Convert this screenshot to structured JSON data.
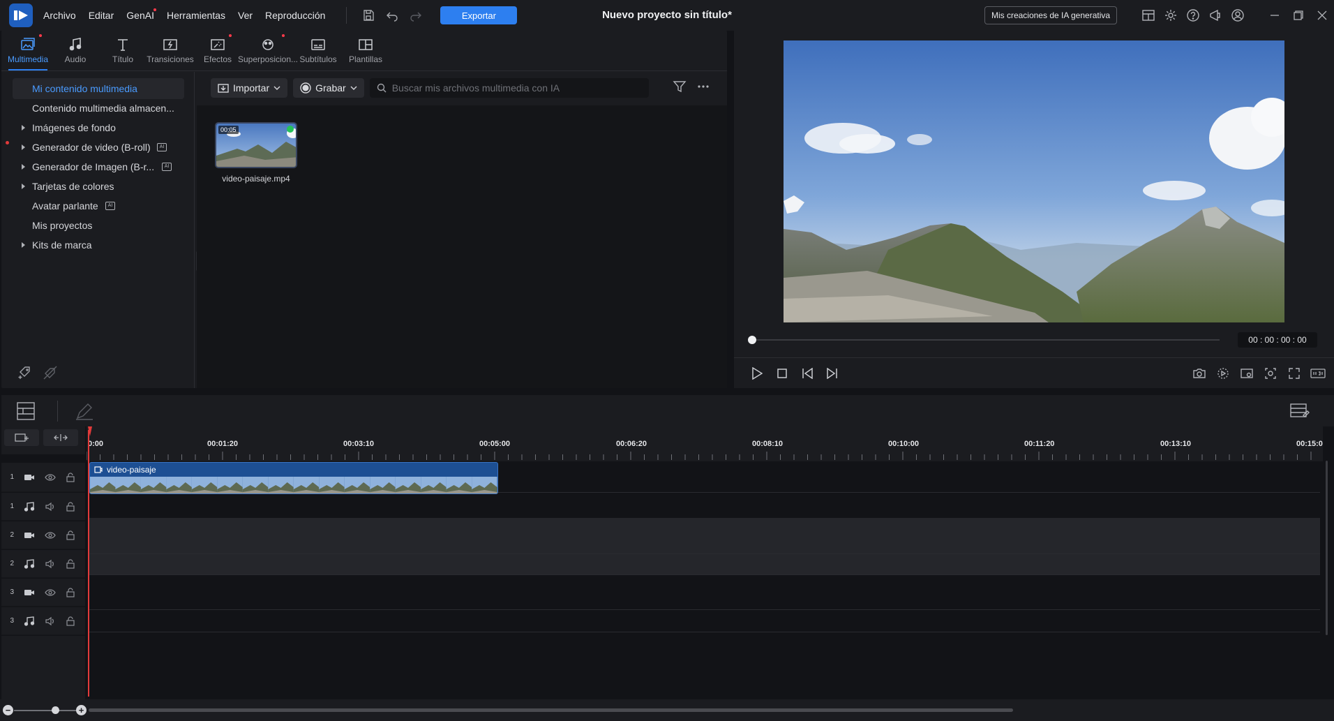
{
  "menu": [
    "Archivo",
    "Editar",
    "GenAI",
    "Herramientas",
    "Ver",
    "Reproducción"
  ],
  "export_label": "Exportar",
  "project_title": "Nuevo proyecto sin título*",
  "genai_creations_label": "Mis creaciones de IA generativa",
  "tabs": [
    {
      "label": "Multimedia",
      "icon": "media-icon"
    },
    {
      "label": "Audio",
      "icon": "music-note-icon"
    },
    {
      "label": "Título",
      "icon": "title-t-icon"
    },
    {
      "label": "Transiciones",
      "icon": "transition-icon"
    },
    {
      "label": "Efectos",
      "icon": "effects-icon"
    },
    {
      "label": "Superposicion...",
      "icon": "overlay-icon"
    },
    {
      "label": "Subtítulos",
      "icon": "subtitles-icon"
    },
    {
      "label": "Plantillas",
      "icon": "templates-icon"
    }
  ],
  "tree": [
    "Mi contenido multimedia",
    "Contenido multimedia almacen...",
    "Imágenes de fondo",
    "Generador de video (B-roll)",
    "Generador de Imagen (B-r...",
    "Tarjetas de colores",
    "Avatar parlante",
    "Mis proyectos",
    "Kits de marca"
  ],
  "ai_badge": "AI",
  "toolbar": {
    "import_label": "Importar",
    "record_label": "Grabar",
    "search_placeholder": "Buscar mis archivos multimedia con IA"
  },
  "media": [
    {
      "name": "video-paisaje.mp4",
      "duration": "00:05"
    }
  ],
  "preview": {
    "timecode": "00 : 00 : 00 : 00"
  },
  "ruler": [
    "0:00",
    "00:01:20",
    "00:03:10",
    "00:05:00",
    "00:06:20",
    "00:08:10",
    "00:10:00",
    "00:11:20",
    "00:13:10",
    "00:15:0"
  ],
  "tracks": [
    {
      "num": "1",
      "type": "video"
    },
    {
      "num": "1",
      "type": "audio"
    },
    {
      "num": "2",
      "type": "video"
    },
    {
      "num": "2",
      "type": "audio"
    },
    {
      "num": "3",
      "type": "video"
    },
    {
      "num": "3",
      "type": "audio"
    }
  ],
  "clip": {
    "label": "video-paisaje"
  },
  "colors": {
    "accent": "#2d7ff0",
    "playhead": "#e23a3a",
    "clip": "#1d4f93"
  }
}
